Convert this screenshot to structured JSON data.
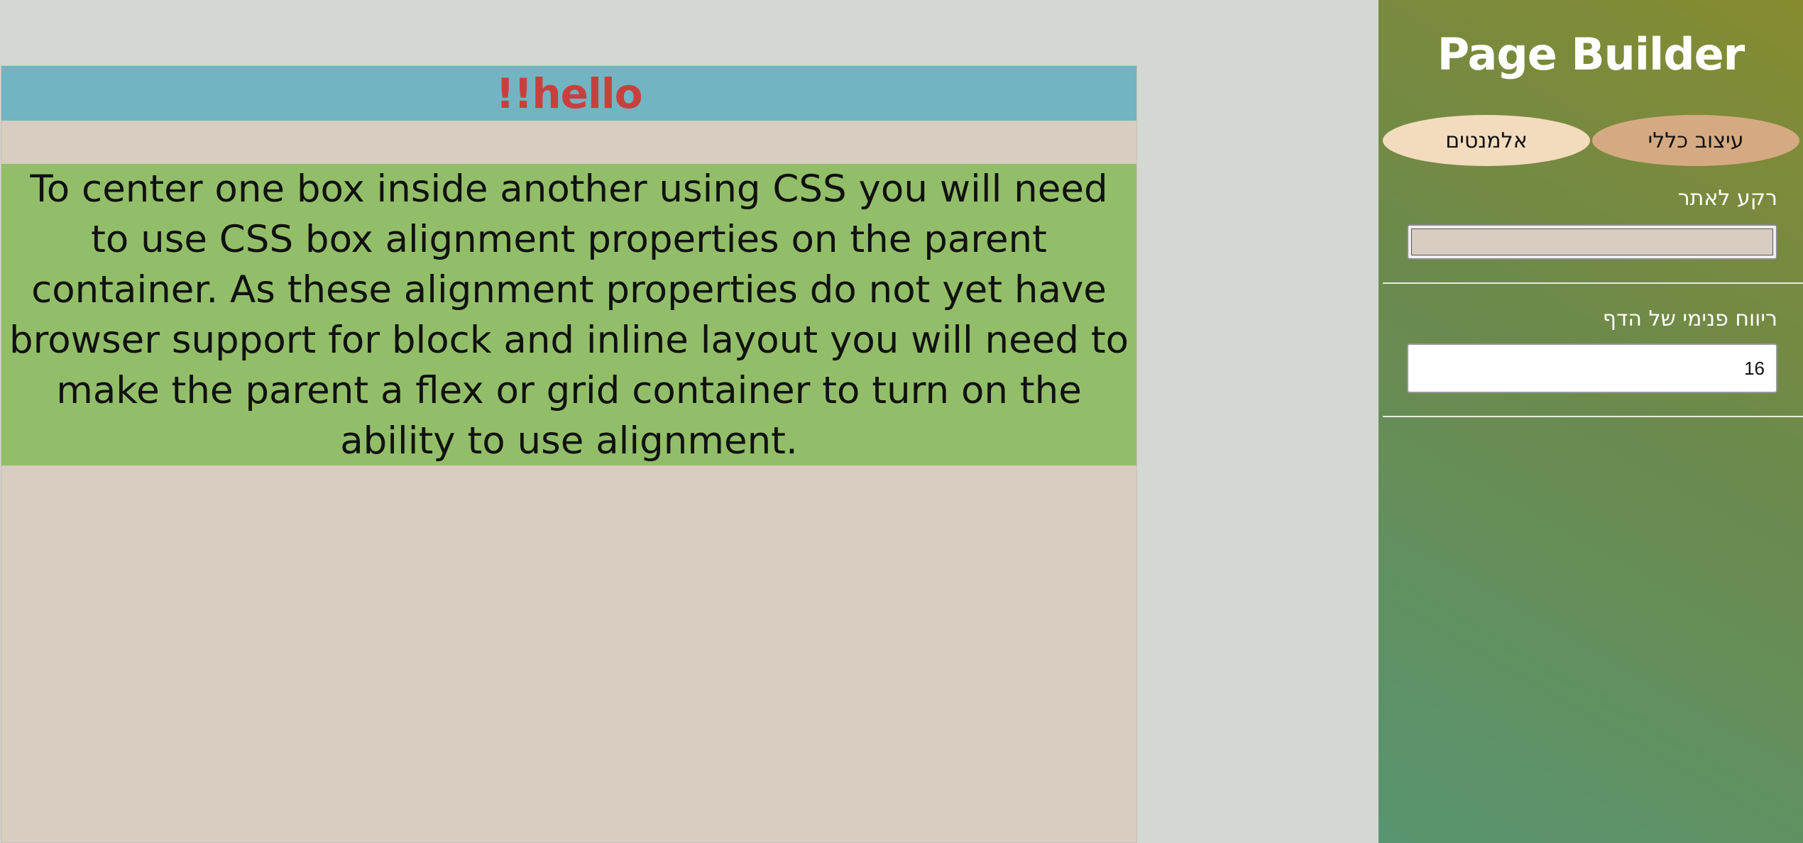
{
  "preview": {
    "header_text": "!!hello",
    "body_text": "To center one box inside another using CSS you will need to use CSS box alignment properties on the parent container. As these alignment properties do not yet have browser support for block and inline layout you will need to make the parent a flex or grid container to turn on the ability to use alignment.",
    "colors": {
      "page_bg": "#d9ccc0",
      "header_bg": "#72b4c1",
      "header_text": "#c8403e",
      "text_block_bg": "#93be69"
    }
  },
  "sidebar": {
    "title": "Page Builder",
    "tabs": [
      {
        "label": "אלמנטים",
        "active": false
      },
      {
        "label": "עיצוב כללי",
        "active": true
      }
    ],
    "fields": {
      "background": {
        "label": "רקע לאתר",
        "value": "#d9ccc0"
      },
      "padding": {
        "label": "ריווח פנימי של הדף",
        "value": "16"
      }
    }
  }
}
